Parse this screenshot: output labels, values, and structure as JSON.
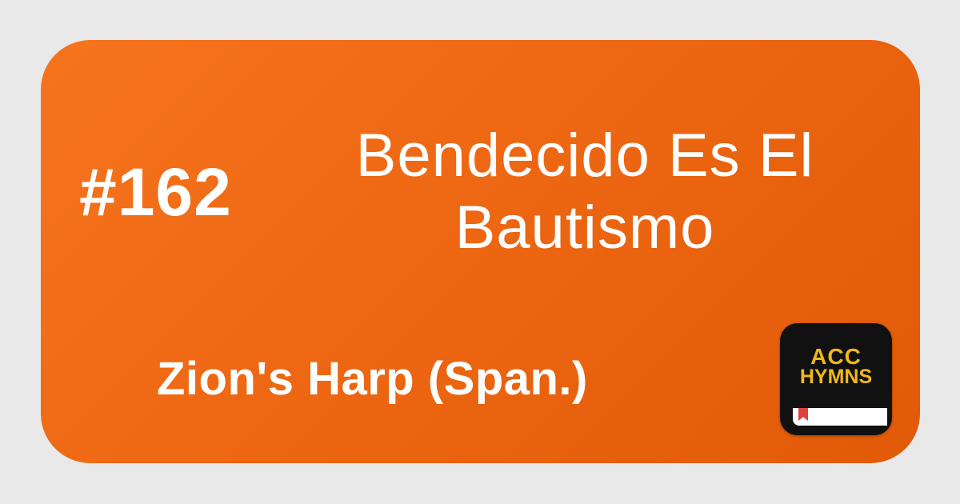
{
  "hymn": {
    "number": "#162",
    "title_line1": "Bendecido Es El",
    "title_line2": "Bautismo",
    "book": "Zion's Harp (Span.)"
  },
  "app_icon": {
    "line1": "ACC",
    "line2": "HYMNS",
    "icon_name": "acc-hymns-app-icon"
  },
  "colors": {
    "background": "#e9e9e9",
    "card_orange_start": "#f6741d",
    "card_orange_end": "#e15a07",
    "text": "#ffffff",
    "icon_bg": "#111111",
    "icon_text": "#f2b71b",
    "ribbon": "#e0403a"
  }
}
